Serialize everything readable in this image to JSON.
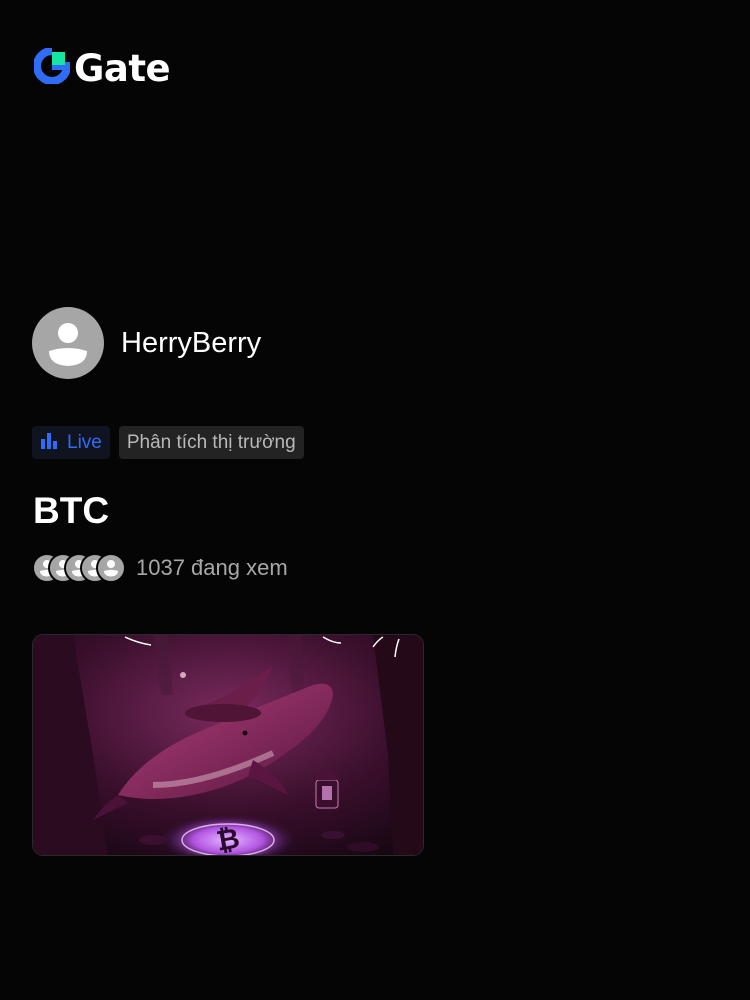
{
  "brand": {
    "name": "Gate",
    "logo_color": "#2f6df6",
    "accent_color": "#17e5a3"
  },
  "host": {
    "name": "HerryBerry",
    "avatar_icon": "user-avatar-icon"
  },
  "tags": {
    "live_label": "Live",
    "live_icon": "bar-chart-icon",
    "live_color": "#2f6df6",
    "category_label": "Phân tích thị trường"
  },
  "stream": {
    "title": "BTC",
    "viewer_count_text": "1037 đang xem",
    "viewer_avatars": 5,
    "thumbnail": "whale-wizard-bitcoin-thumbnail"
  }
}
